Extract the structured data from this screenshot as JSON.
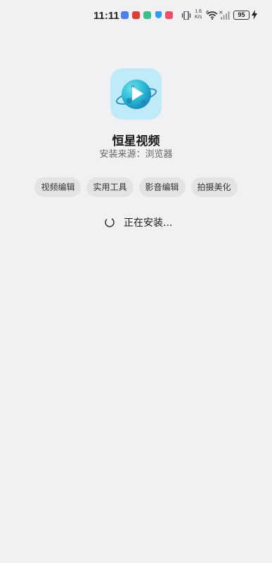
{
  "status_bar": {
    "time": "11:11",
    "net_speed_value": "1.6",
    "net_speed_unit": "K/s",
    "signal_label": "6",
    "battery": "95",
    "icons": [
      "notification-app-icon",
      "notification-mail-icon",
      "notification-download-icon",
      "notification-shield-icon",
      "notification-app2-icon",
      "vibrate-icon",
      "wifi-icon",
      "signal-icon",
      "battery-icon",
      "charging-icon"
    ]
  },
  "app": {
    "name": "恒星视频",
    "source": "安装来源：浏览器",
    "icon": "planet-play-icon"
  },
  "tags": [
    "视频编辑",
    "实用工具",
    "影音编辑",
    "拍摄美化"
  ],
  "install": {
    "status": "正在安装..."
  },
  "colors": {
    "background": "#f1f1f3",
    "tag_background": "#e3e3e6",
    "icon_background": "#bfeaf8",
    "planet": "#2bb3d8"
  }
}
